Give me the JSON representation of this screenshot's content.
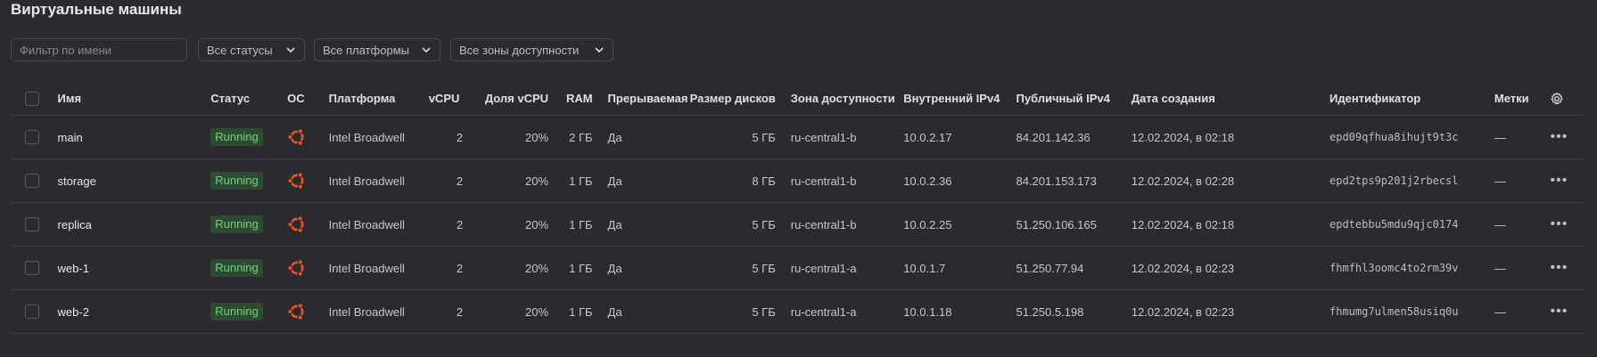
{
  "page": {
    "title": "Виртуальные машины"
  },
  "filters": {
    "name_placeholder": "Фильтр по имени",
    "status": "Все статусы",
    "platform": "Все платформы",
    "zone": "Все зоны доступности"
  },
  "columns": {
    "name": "Имя",
    "status": "Статус",
    "os": "ОС",
    "platform": "Платформа",
    "vcpu": "vCPU",
    "vcpu_share": "Доля vCPU",
    "ram": "RAM",
    "preemptible": "Прерываемая",
    "disk_size": "Размер дисков",
    "zone": "Зона доступности",
    "internal_ip": "Внутренний IPv4",
    "public_ip": "Публичный IPv4",
    "created": "Дата создания",
    "id": "Идентификатор",
    "labels": "Метки"
  },
  "icons": {
    "os": "ubuntu-icon",
    "settings": "gear-icon",
    "actions": "more-icon"
  },
  "colors": {
    "running_bg": "#2f4a33",
    "running_text": "#6fd27a",
    "ubuntu": "#e95420"
  },
  "rows": [
    {
      "name": "main",
      "status": "Running",
      "platform": "Intel Broadwell",
      "vcpu": "2",
      "vcpu_share": "20%",
      "ram": "2 ГБ",
      "preemptible": "Да",
      "disk": "5 ГБ",
      "zone": "ru-central1-b",
      "internal_ip": "10.0.2.17",
      "public_ip": "84.201.142.36",
      "created": "12.02.2024, в 02:18",
      "id": "epd09qfhua8ihujt9t3c",
      "labels": "—"
    },
    {
      "name": "storage",
      "status": "Running",
      "platform": "Intel Broadwell",
      "vcpu": "2",
      "vcpu_share": "20%",
      "ram": "1 ГБ",
      "preemptible": "Да",
      "disk": "8 ГБ",
      "zone": "ru-central1-b",
      "internal_ip": "10.0.2.36",
      "public_ip": "84.201.153.173",
      "created": "12.02.2024, в 02:28",
      "id": "epd2tps9p201j2rbecsl",
      "labels": "—"
    },
    {
      "name": "replica",
      "status": "Running",
      "platform": "Intel Broadwell",
      "vcpu": "2",
      "vcpu_share": "20%",
      "ram": "1 ГБ",
      "preemptible": "Да",
      "disk": "5 ГБ",
      "zone": "ru-central1-b",
      "internal_ip": "10.0.2.25",
      "public_ip": "51.250.106.165",
      "created": "12.02.2024, в 02:18",
      "id": "epdtebbu5mdu9qjc0174",
      "labels": "—"
    },
    {
      "name": "web-1",
      "status": "Running",
      "platform": "Intel Broadwell",
      "vcpu": "2",
      "vcpu_share": "20%",
      "ram": "1 ГБ",
      "preemptible": "Да",
      "disk": "5 ГБ",
      "zone": "ru-central1-a",
      "internal_ip": "10.0.1.7",
      "public_ip": "51.250.77.94",
      "created": "12.02.2024, в 02:23",
      "id": "fhmfhl3oomc4to2rm39v",
      "labels": "—"
    },
    {
      "name": "web-2",
      "status": "Running",
      "platform": "Intel Broadwell",
      "vcpu": "2",
      "vcpu_share": "20%",
      "ram": "1 ГБ",
      "preemptible": "Да",
      "disk": "5 ГБ",
      "zone": "ru-central1-a",
      "internal_ip": "10.0.1.18",
      "public_ip": "51.250.5.198",
      "created": "12.02.2024, в 02:23",
      "id": "fhmumg7ulmen58usiq0u",
      "labels": "—"
    }
  ]
}
